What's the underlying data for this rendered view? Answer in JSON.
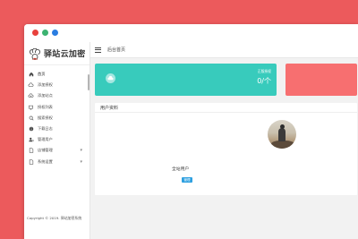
{
  "window": {
    "controls": [
      "close",
      "minimize",
      "maximize"
    ]
  },
  "logo": {
    "text": "驿站云加密"
  },
  "sidebar": {
    "items": [
      {
        "label": "首页",
        "icon": "home-icon"
      },
      {
        "label": "添加授权",
        "icon": "cloud-icon"
      },
      {
        "label": "添加站点",
        "icon": "cloud-add-icon"
      },
      {
        "label": "授权列表",
        "icon": "monitor-icon"
      },
      {
        "label": "搜索授权",
        "icon": "search-icon"
      },
      {
        "label": "下载日志",
        "icon": "info-icon"
      },
      {
        "label": "管理用户",
        "icon": "user-gear-icon"
      },
      {
        "label": "店铺管理",
        "icon": "document-icon",
        "has_children": true
      },
      {
        "label": "系统设置",
        "icon": "document-icon",
        "has_children": true
      }
    ],
    "copyright": "Copyright © 2019. 驿站加密系统"
  },
  "topbar": {
    "breadcrumb": "后台首页"
  },
  "stats": {
    "teal_card": {
      "label": "正版授权",
      "value": "0/个",
      "color": "#38cbbc"
    },
    "red_card": {
      "color": "#f76f70"
    }
  },
  "user_panel": {
    "title": "用户资料",
    "username": "全站用户",
    "badge": "管理"
  }
}
